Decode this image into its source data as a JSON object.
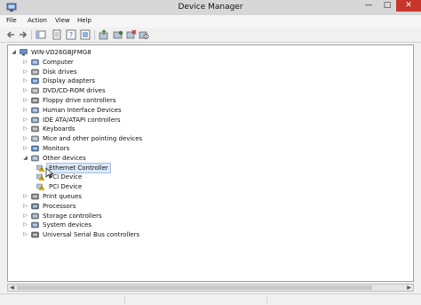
{
  "window": {
    "title": "Device Manager"
  },
  "titlebar_buttons": {
    "minimize": "—",
    "maximize": "□",
    "close": "✕"
  },
  "menu": [
    "File",
    "Action",
    "View",
    "Help"
  ],
  "toolbar": {
    "buttons": [
      "back-arrow-icon",
      "forward-arrow-icon",
      "properties-window-icon",
      "show-hide-console-tree-icon",
      "help-icon",
      "update-driver-icon",
      "scan-hardware-icon",
      "uninstall-device-icon",
      "disable-device-icon"
    ]
  },
  "tree": {
    "root": "WIN-VD26GBJFMG8",
    "categories": [
      {
        "label": "Computer",
        "icon": "computer-icon"
      },
      {
        "label": "Disk drives",
        "icon": "disk-drive-icon"
      },
      {
        "label": "Display adapters",
        "icon": "display-adapter-icon"
      },
      {
        "label": "DVD/CD-ROM drives",
        "icon": "dvd-drive-icon"
      },
      {
        "label": "Floppy drive controllers",
        "icon": "floppy-controller-icon"
      },
      {
        "label": "Human Interface Devices",
        "icon": "hid-icon"
      },
      {
        "label": "IDE ATA/ATAPI controllers",
        "icon": "ide-controller-icon"
      },
      {
        "label": "Keyboards",
        "icon": "keyboard-icon"
      },
      {
        "label": "Mice and other pointing devices",
        "icon": "mouse-icon"
      },
      {
        "label": "Monitors",
        "icon": "monitor-icon"
      },
      {
        "label": "Other devices",
        "icon": "other-devices-icon",
        "expanded": true
      },
      {
        "label": "Print queues",
        "icon": "printer-icon"
      },
      {
        "label": "Processors",
        "icon": "processor-icon"
      },
      {
        "label": "Storage controllers",
        "icon": "storage-controller-icon"
      },
      {
        "label": "System devices",
        "icon": "system-device-icon"
      },
      {
        "label": "Universal Serial Bus controllers",
        "icon": "usb-icon"
      }
    ],
    "other_devices_children": [
      {
        "label": "Ethernet Controller",
        "icon": "warning-device-icon",
        "selected": true
      },
      {
        "label": "PCI Device",
        "icon": "warning-device-icon"
      },
      {
        "label": "PCI Device",
        "icon": "warning-device-icon"
      }
    ]
  },
  "colors": {
    "close_button": "#c7362a",
    "selection": "#dbe8f7",
    "warning": "#f2c200"
  }
}
